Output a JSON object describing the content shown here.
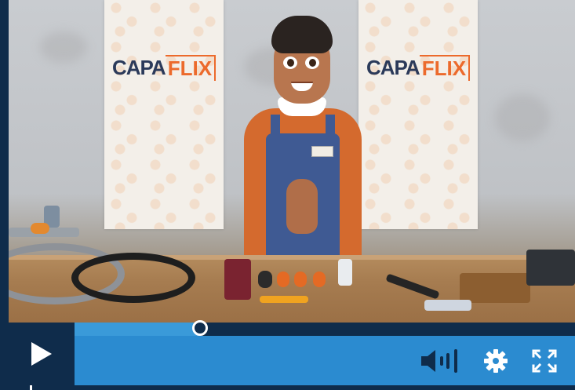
{
  "player": {
    "brand_left": "CAPA",
    "brand_right": "FLIX",
    "progress": 0.25,
    "colors": {
      "frame": "#0f2c4b",
      "bar": "#2b8bd0",
      "played": "#3a9ad9",
      "accent": "#ec6a2c"
    },
    "controls": {
      "play_icon": "play-icon",
      "volume_icon": "volume-icon",
      "settings_icon": "gear-icon",
      "fullscreen_icon": "fullscreen-icon"
    }
  }
}
